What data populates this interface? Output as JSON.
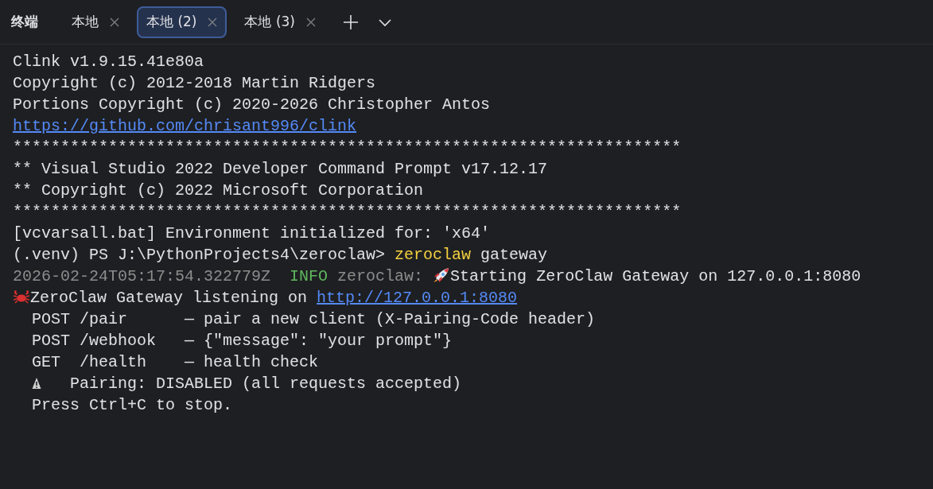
{
  "header": {
    "title": "终端",
    "tabs": [
      {
        "label": "本地",
        "selected": false
      },
      {
        "label": "本地 (2)",
        "selected": true
      },
      {
        "label": "本地 (3)",
        "selected": false
      }
    ]
  },
  "terminal": {
    "lines": [
      {
        "segments": [
          {
            "kind": "text",
            "text": "Clink v1.9.15.41e80a"
          }
        ]
      },
      {
        "segments": [
          {
            "kind": "text",
            "text": "Copyright (c) 2012-2018 Martin Ridgers"
          }
        ]
      },
      {
        "segments": [
          {
            "kind": "text",
            "text": "Portions Copyright (c) 2020-2026 Christopher Antos"
          }
        ]
      },
      {
        "segments": [
          {
            "kind": "link",
            "text": "https://github.com/chrisant996/clink"
          }
        ]
      },
      {
        "segments": [
          {
            "kind": "text",
            "text": "**********************************************************************"
          }
        ]
      },
      {
        "segments": [
          {
            "kind": "text",
            "text": "** Visual Studio 2022 Developer Command Prompt v17.12.17"
          }
        ]
      },
      {
        "segments": [
          {
            "kind": "text",
            "text": "** Copyright (c) 2022 Microsoft Corporation"
          }
        ]
      },
      {
        "segments": [
          {
            "kind": "text",
            "text": "**********************************************************************"
          }
        ]
      },
      {
        "segments": [
          {
            "kind": "text",
            "text": "[vcvarsall.bat] Environment initialized for: 'x64'"
          }
        ]
      },
      {
        "segments": [
          {
            "kind": "text",
            "text": "(.venv) PS J:\\PythonProjects4\\zeroclaw> "
          },
          {
            "kind": "command",
            "text": "zeroclaw"
          },
          {
            "kind": "text",
            "text": " gateway"
          }
        ]
      },
      {
        "segments": [
          {
            "kind": "dim",
            "text": "2026-02-24T05:17:54.322779Z  "
          },
          {
            "kind": "info",
            "text": "INFO"
          },
          {
            "kind": "dim",
            "text": " zeroclaw: "
          },
          {
            "kind": "rocket"
          },
          {
            "kind": "text",
            "text": "Starting ZeroClaw Gateway on 127.0.0.1:8080"
          }
        ]
      },
      {
        "segments": [
          {
            "kind": "crab"
          },
          {
            "kind": "text",
            "text": "ZeroClaw Gateway listening on "
          },
          {
            "kind": "link",
            "text": "http://127.0.0.1:8080"
          }
        ]
      },
      {
        "segments": [
          {
            "kind": "text",
            "text": "  POST /pair      — pair a new client (X-Pairing-Code header)"
          }
        ]
      },
      {
        "segments": [
          {
            "kind": "text",
            "text": "  POST /webhook   — {\"message\": \"your prompt\"}"
          }
        ]
      },
      {
        "segments": [
          {
            "kind": "text",
            "text": "  GET  /health    — health check"
          }
        ]
      },
      {
        "segments": [
          {
            "kind": "warning"
          },
          {
            "kind": "text",
            "text": "   Pairing: DISABLED (all requests accepted)"
          }
        ]
      },
      {
        "segments": [
          {
            "kind": "text",
            "text": "  Press Ctrl+C to stop."
          }
        ]
      }
    ]
  }
}
